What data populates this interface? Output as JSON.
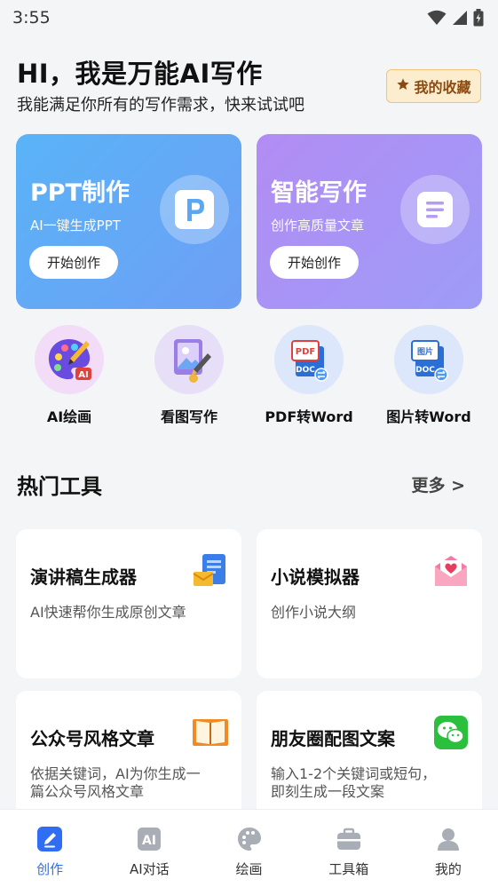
{
  "status_bar": {
    "time": "3:55"
  },
  "header": {
    "title": "HI，我是万能AI写作",
    "subtitle": "我能满足你所有的写作需求，快来试试吧",
    "favorites_label": "我的收藏"
  },
  "hero_cards": [
    {
      "title": "PPT制作",
      "subtitle": "AI一键生成PPT",
      "button": "开始创作",
      "icon": "ppt-icon"
    },
    {
      "title": "智能写作",
      "subtitle": "创作高质量文章",
      "button": "开始创作",
      "icon": "document-icon"
    }
  ],
  "quick_tools": [
    {
      "label": "AI绘画",
      "icon": "ai-palette-icon"
    },
    {
      "label": "看图写作",
      "icon": "image-writing-icon"
    },
    {
      "label": "PDF转Word",
      "icon": "pdf-to-word-icon"
    },
    {
      "label": "图片转Word",
      "icon": "image-to-word-icon"
    }
  ],
  "hot_tools": {
    "title": "热门工具",
    "more": "更多 >",
    "items": [
      {
        "title": "演讲稿生成器",
        "desc": "AI快速帮你生成原创文章",
        "icon": "speech-doc-icon"
      },
      {
        "title": "小说模拟器",
        "desc": "创作小说大纲",
        "icon": "love-letter-icon"
      },
      {
        "title": "公众号风格文章",
        "desc": "依据关键词，AI为你生成一篇公众号风格文章",
        "icon": "open-book-icon"
      },
      {
        "title": "朋友圈配图文案",
        "desc": "输入1-2个关键词或短句，即刻生成一段文案",
        "icon": "wechat-icon"
      }
    ]
  },
  "bottom_nav": [
    {
      "label": "创作",
      "icon": "pen-icon",
      "active": true
    },
    {
      "label": "AI对话",
      "icon": "ai-chat-icon",
      "active": false
    },
    {
      "label": "绘画",
      "icon": "palette-icon",
      "active": false
    },
    {
      "label": "工具箱",
      "icon": "toolbox-icon",
      "active": false
    },
    {
      "label": "我的",
      "icon": "user-icon",
      "active": false
    }
  ],
  "colors": {
    "accent": "#2f6df2",
    "ppt_card": "#59b3f7",
    "write_card": "#b28cf4",
    "favorites_bg": "#fdedcf"
  }
}
